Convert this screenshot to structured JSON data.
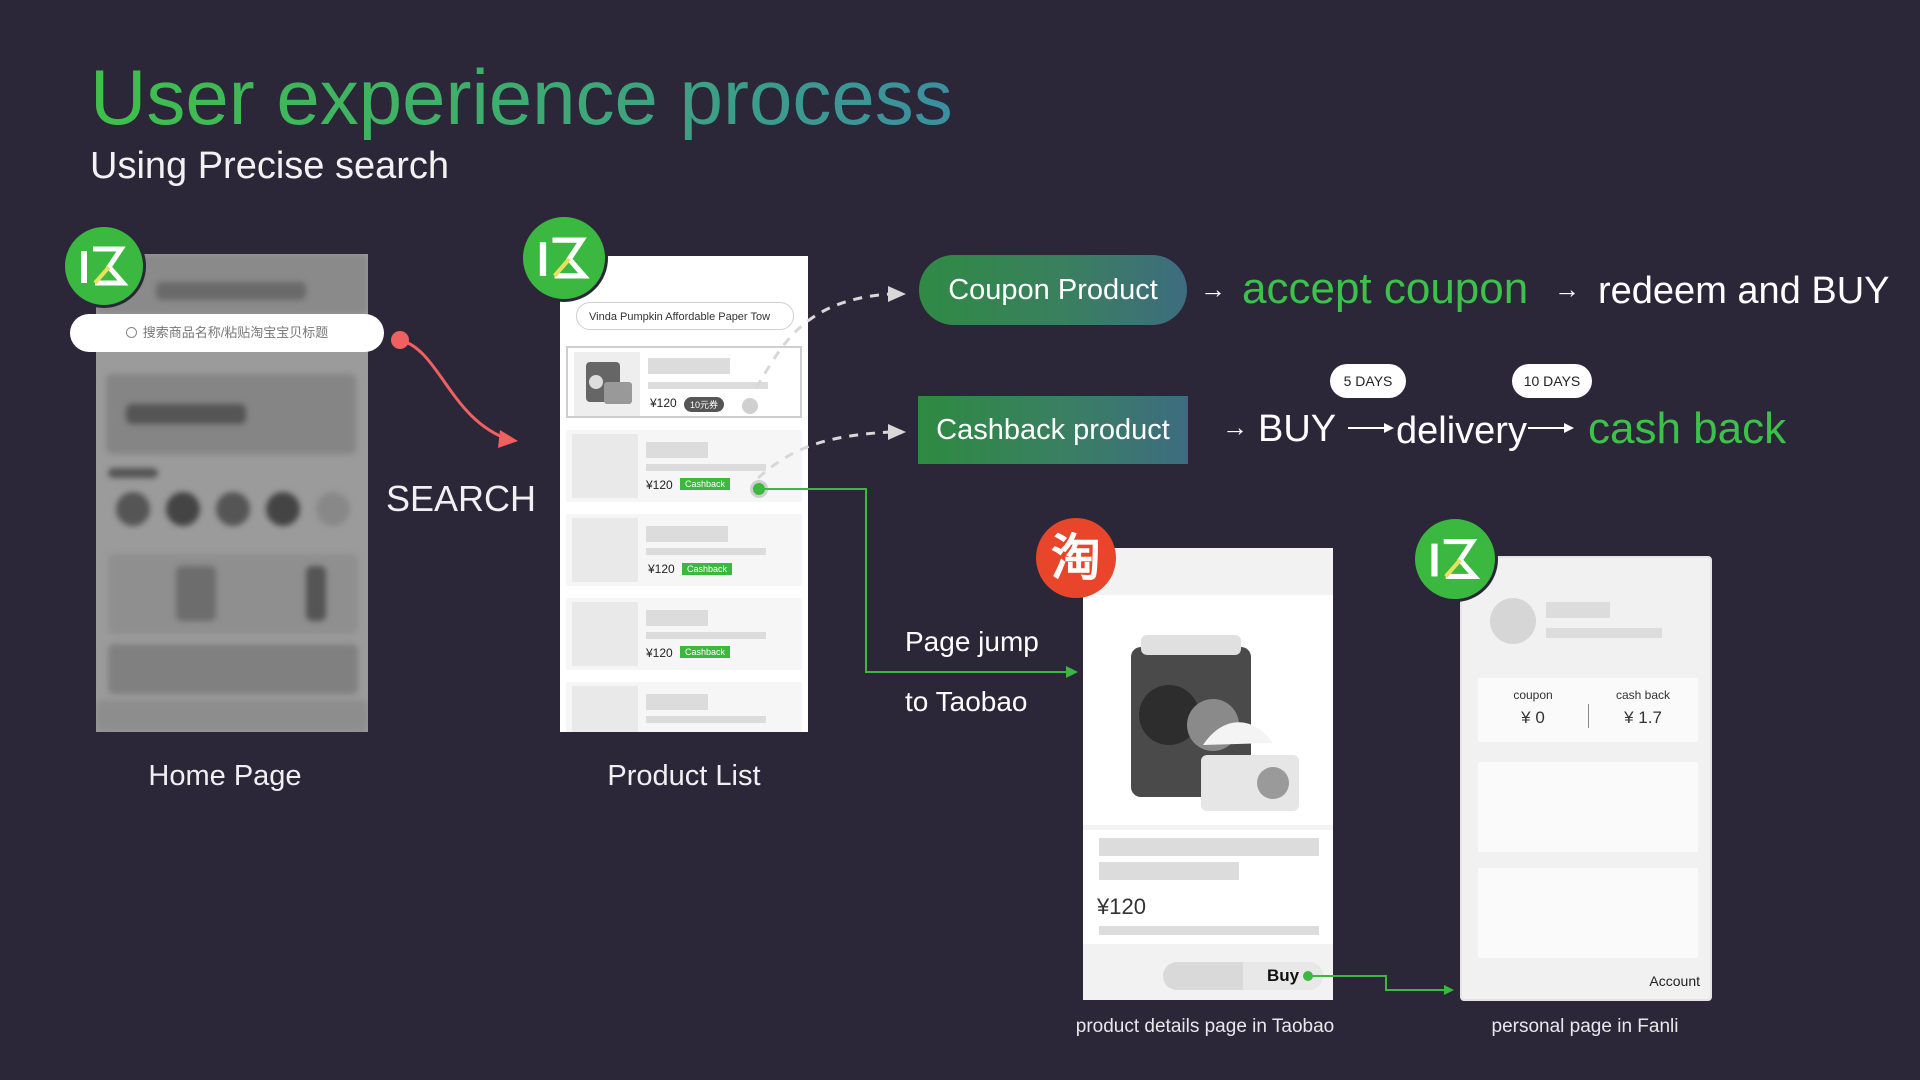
{
  "header": {
    "title": "User experience process",
    "subtitle": "Using Precise search"
  },
  "home": {
    "search_placeholder": "搜索商品名称/粘贴淘宝宝贝标题",
    "caption": "Home Page"
  },
  "search_label": "SEARCH",
  "product_list": {
    "caption": "Product List",
    "search_query": "Vinda Pumpkin Affordable Paper Tow",
    "rows": [
      {
        "price": "¥120",
        "tag": "10元券"
      },
      {
        "price": "¥120",
        "tag": "Cashback"
      },
      {
        "price": "¥120",
        "tag": "Cashback"
      },
      {
        "price": "¥120",
        "tag": "Cashback"
      }
    ]
  },
  "flow": {
    "coupon_product": "Coupon Product",
    "accept_coupon": "accept coupon",
    "redeem_buy": "redeem and BUY",
    "cashback_product": "Cashback product",
    "buy": "BUY",
    "delivery": "delivery",
    "cash_back": "cash back",
    "days_1": "5 DAYS",
    "days_2": "10 DAYS"
  },
  "page_jump": {
    "line1": "Page jump",
    "line2": "to Taobao"
  },
  "taobao": {
    "logo_char": "淘",
    "price": "¥120",
    "buy_label": "Buy",
    "caption": "product details page in Taobao"
  },
  "fanli": {
    "coupon_label": "coupon",
    "coupon_value": "¥ 0",
    "cashback_label": "cash back",
    "cashback_value": "¥ 1.7",
    "account_label": "Account",
    "caption": "personal page in Fanli"
  },
  "colors": {
    "background": "#2b2739",
    "accent_green": "#3cc14a",
    "link_red": "#f06060",
    "taobao_orange": "#e8452a"
  }
}
